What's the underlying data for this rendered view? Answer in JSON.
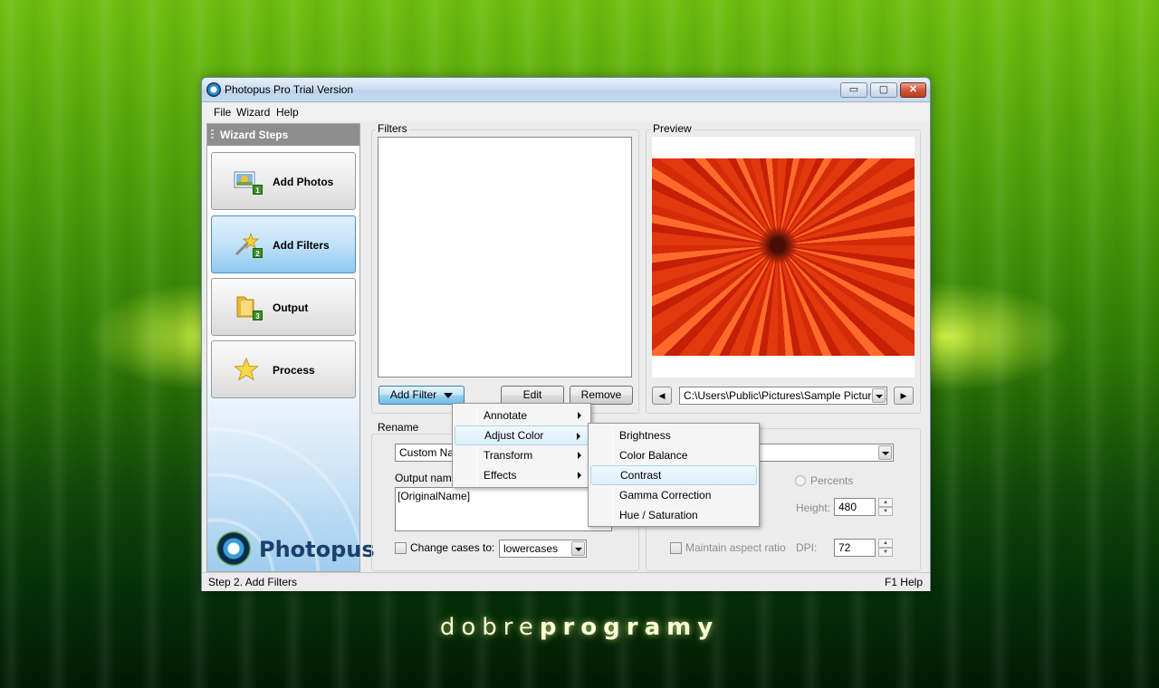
{
  "window": {
    "title": "Photopus Pro Trial Version",
    "buttons": {
      "min": "▭",
      "max": "▢",
      "close": "✕"
    }
  },
  "menubar": {
    "file": "File",
    "wizard": "Wizard",
    "help": "Help"
  },
  "wizard": {
    "header": "Wizard Steps",
    "steps": [
      {
        "label": "Add Photos",
        "num": "1",
        "icon": "photos-icon"
      },
      {
        "label": "Add Filters",
        "num": "2",
        "icon": "magic-wand-icon",
        "active": true
      },
      {
        "label": "Output",
        "num": "3",
        "icon": "folder-icon"
      },
      {
        "label": "Process",
        "num": "",
        "icon": "star-icon"
      }
    ],
    "logo_text": "Photopus"
  },
  "filters": {
    "legend": "Filters",
    "add_filter": "Add Filter",
    "edit": "Edit",
    "remove": "Remove"
  },
  "preview": {
    "legend": "Preview",
    "path": "C:\\Users\\Public\\Pictures\\Sample Pictures\\",
    "prev": "◀",
    "next": "▶"
  },
  "rename": {
    "legend": "Rename",
    "mode": "Custom Name",
    "output_name_label": "Output name",
    "output_name_value": "[OriginalName]",
    "change_cases_label": "Change cases to:",
    "case_value": "lowercases"
  },
  "resize": {
    "percents_label": "Percents",
    "height_label": "Height:",
    "height_value": "480",
    "maintain_label": "Maintain aspect ratio",
    "dpi_label": "DPI:",
    "dpi_value": "72"
  },
  "context_menu": {
    "items": [
      "Annotate",
      "Adjust Color",
      "Transform",
      "Effects"
    ],
    "highlighted": "Adjust Color"
  },
  "submenu": {
    "items": [
      "Brightness",
      "Color Balance",
      "Contrast",
      "Gamma Correction",
      "Hue / Saturation"
    ],
    "highlighted": "Contrast"
  },
  "statusbar": {
    "left": "Step 2. Add Filters",
    "right": "F1 Help"
  },
  "background_brand": {
    "part1": "dobre",
    "part2": "programy"
  },
  "colors": {
    "accent": "#6fc0ea",
    "background_green": "#2e7a06"
  }
}
